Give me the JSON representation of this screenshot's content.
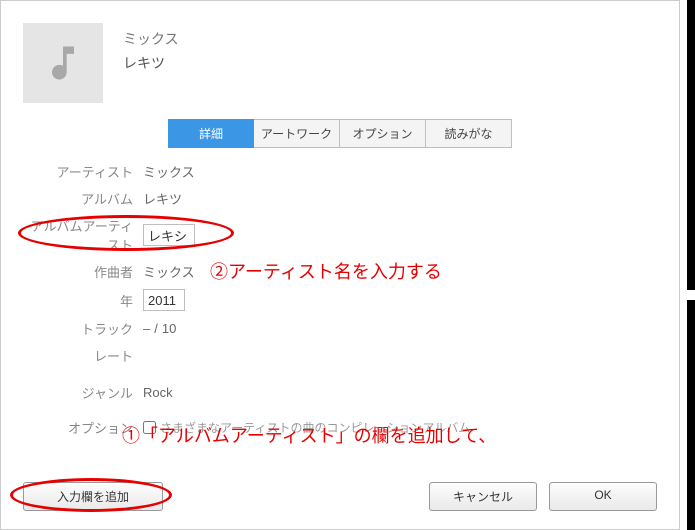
{
  "header": {
    "title": "ミックス",
    "subtitle": "レキツ"
  },
  "tabs": {
    "details": "詳細",
    "artwork": "アートワーク",
    "options": "オプション",
    "yomi": "読みがな"
  },
  "form": {
    "artist_label": "アーティスト",
    "artist_value": "ミックス",
    "album_label": "アルバム",
    "album_value": "レキツ",
    "album_artist_label": "アルバムアーティスト",
    "album_artist_value": "レキシ",
    "composer_label": "作曲者",
    "composer_value": "ミックス",
    "year_label": "年",
    "year_value": "2011",
    "track_label": "トラック",
    "track_dash": "–",
    "track_sep": "/",
    "track_total": "10",
    "rate_label": "レート",
    "genre_label": "ジャンル",
    "genre_value": "Rock",
    "option_label": "オプション",
    "option_text": "さまざまなアーティストの曲のコンピレーションアルバム"
  },
  "buttons": {
    "add_field": "入力欄を追加",
    "cancel": "キャンセル",
    "ok": "OK"
  },
  "annotations": {
    "note1": "①「アルバムアーティスト」の欄を追加して、",
    "note2": "②アーティスト名を入力する"
  }
}
